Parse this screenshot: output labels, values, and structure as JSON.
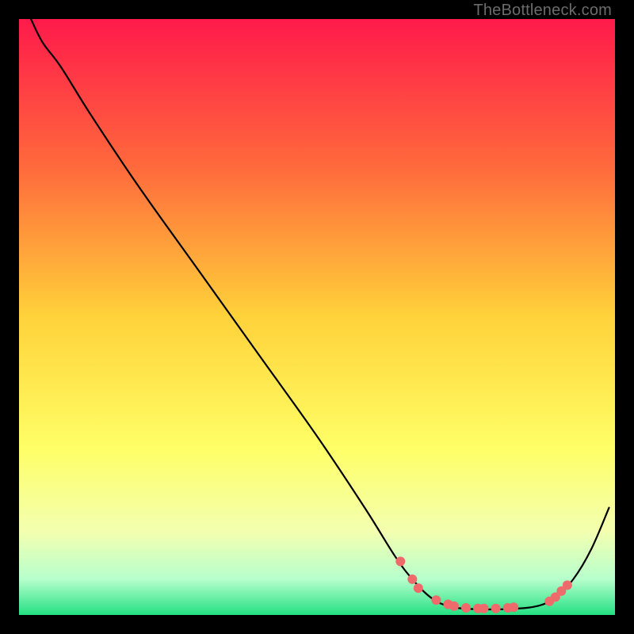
{
  "watermark": "TheBottleneck.com",
  "chart_data": {
    "type": "line",
    "title": "",
    "xlabel": "",
    "ylabel": "",
    "xlim": [
      0,
      100
    ],
    "ylim": [
      0,
      100
    ],
    "background_gradient": {
      "stops": [
        {
          "offset": 0,
          "color": "#ff1a4b"
        },
        {
          "offset": 25,
          "color": "#ff6a3c"
        },
        {
          "offset": 50,
          "color": "#ffd23a"
        },
        {
          "offset": 72,
          "color": "#ffff66"
        },
        {
          "offset": 86,
          "color": "#f3ffb0"
        },
        {
          "offset": 94,
          "color": "#b6ffcd"
        },
        {
          "offset": 100,
          "color": "#23e082"
        }
      ]
    },
    "series": [
      {
        "name": "curve",
        "color": "#000000",
        "points": [
          {
            "x": 2,
            "y": 100
          },
          {
            "x": 4,
            "y": 96
          },
          {
            "x": 7,
            "y": 92
          },
          {
            "x": 12,
            "y": 84
          },
          {
            "x": 20,
            "y": 72
          },
          {
            "x": 30,
            "y": 58
          },
          {
            "x": 40,
            "y": 44
          },
          {
            "x": 50,
            "y": 30
          },
          {
            "x": 58,
            "y": 18
          },
          {
            "x": 63,
            "y": 10
          },
          {
            "x": 66,
            "y": 6
          },
          {
            "x": 69,
            "y": 3
          },
          {
            "x": 72,
            "y": 1.5
          },
          {
            "x": 76,
            "y": 1
          },
          {
            "x": 82,
            "y": 1
          },
          {
            "x": 87,
            "y": 1.5
          },
          {
            "x": 90,
            "y": 3
          },
          {
            "x": 93,
            "y": 6
          },
          {
            "x": 96,
            "y": 11
          },
          {
            "x": 99,
            "y": 18
          }
        ]
      }
    ],
    "markers": {
      "name": "dots",
      "color": "#ef6a6a",
      "radius_px": 6,
      "points": [
        {
          "x": 64,
          "y": 9
        },
        {
          "x": 66,
          "y": 6
        },
        {
          "x": 67,
          "y": 4.5
        },
        {
          "x": 70,
          "y": 2.5
        },
        {
          "x": 72,
          "y": 1.8
        },
        {
          "x": 73,
          "y": 1.5
        },
        {
          "x": 75,
          "y": 1.2
        },
        {
          "x": 77,
          "y": 1.1
        },
        {
          "x": 78,
          "y": 1.1
        },
        {
          "x": 80,
          "y": 1.1
        },
        {
          "x": 82,
          "y": 1.2
        },
        {
          "x": 83,
          "y": 1.3
        },
        {
          "x": 89,
          "y": 2.3
        },
        {
          "x": 90,
          "y": 3
        },
        {
          "x": 91,
          "y": 4
        },
        {
          "x": 92,
          "y": 5
        }
      ]
    }
  }
}
